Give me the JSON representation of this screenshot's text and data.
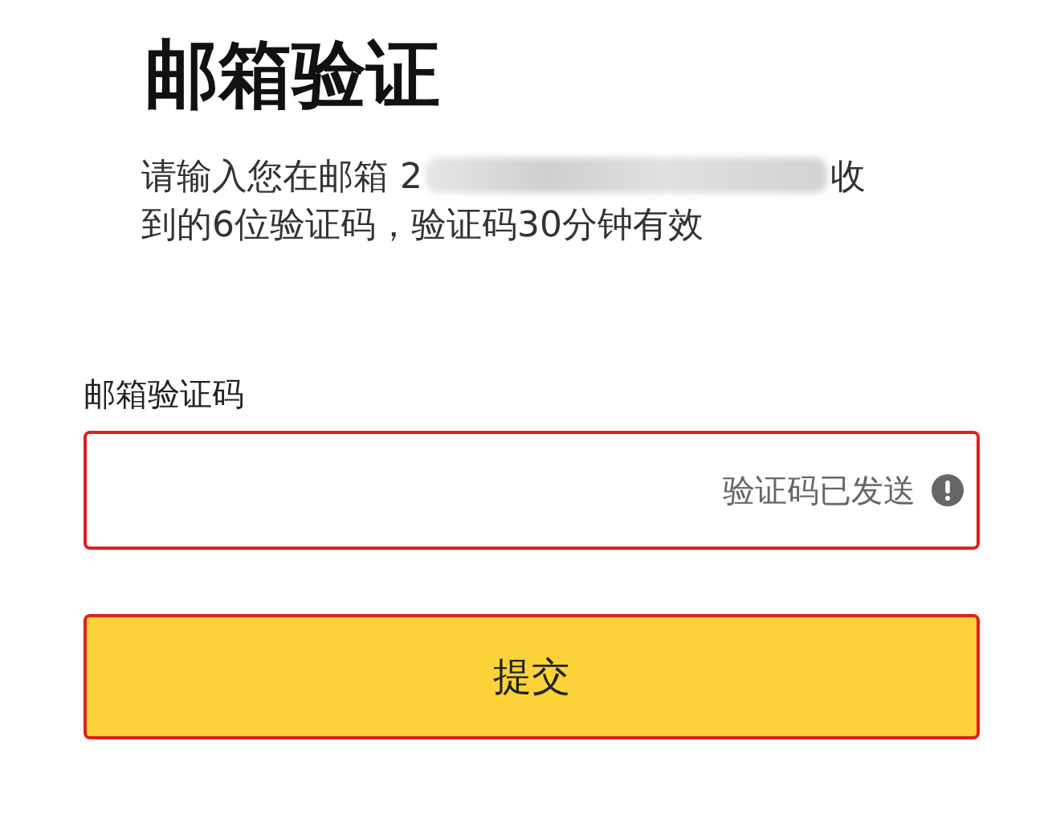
{
  "title": "邮箱验证",
  "description": {
    "before_redaction": "请输入您在邮箱 2",
    "after_redaction": "收",
    "line_2": "到的6位验证码，验证码30分钟有效",
    "redacted": true
  },
  "code_field": {
    "label": "邮箱验证码",
    "status": "验证码已发送",
    "error": true
  },
  "submit_button": {
    "label": "提交"
  }
}
